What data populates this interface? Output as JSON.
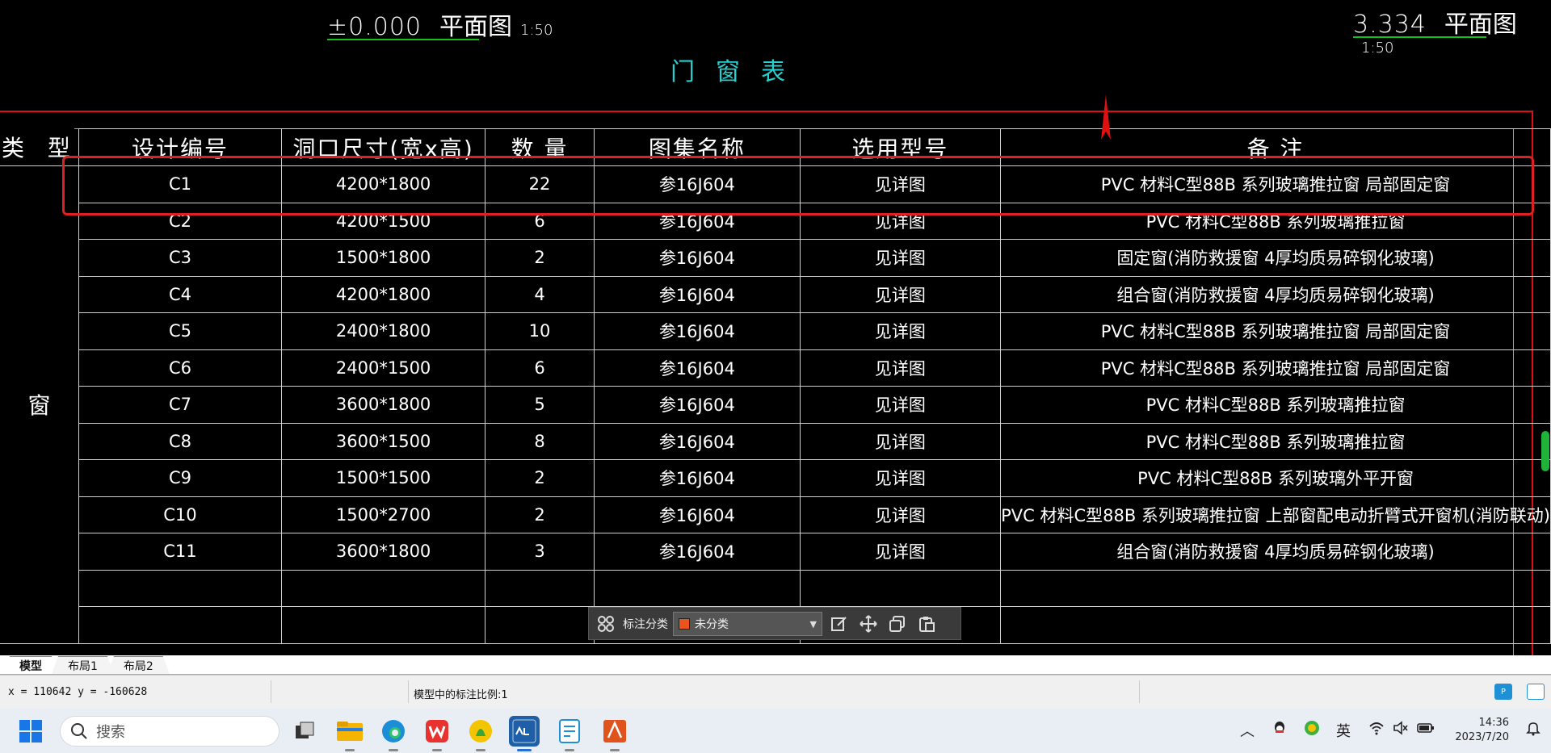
{
  "drawing": {
    "plan_left": {
      "elevation": "±0.000",
      "name": "平面图",
      "scale": "1:50"
    },
    "plan_right": {
      "elevation": "3.334",
      "name": "平面图",
      "scale": "1:50"
    },
    "table_title": "门窗表",
    "headers": [
      "类 型",
      "设计编号",
      "洞口尺寸(宽x高)",
      "数 量",
      "图集名称",
      "选用型号",
      "备 注"
    ],
    "type_label": "窗",
    "rows": [
      {
        "code": "C1",
        "size": "4200*1800",
        "qty": "22",
        "atlas": "参16J604",
        "model": "见详图",
        "note": "PVC 材料C型88B 系列玻璃推拉窗 局部固定窗"
      },
      {
        "code": "C2",
        "size": "4200*1500",
        "qty": "6",
        "atlas": "参16J604",
        "model": "见详图",
        "note": "PVC 材料C型88B 系列玻璃推拉窗"
      },
      {
        "code": "C3",
        "size": "1500*1800",
        "qty": "2",
        "atlas": "参16J604",
        "model": "见详图",
        "note": "固定窗(消防救援窗 4厚均质易碎钢化玻璃)"
      },
      {
        "code": "C4",
        "size": "4200*1800",
        "qty": "4",
        "atlas": "参16J604",
        "model": "见详图",
        "note": "组合窗(消防救援窗 4厚均质易碎钢化玻璃)"
      },
      {
        "code": "C5",
        "size": "2400*1800",
        "qty": "10",
        "atlas": "参16J604",
        "model": "见详图",
        "note": "PVC 材料C型88B 系列玻璃推拉窗 局部固定窗"
      },
      {
        "code": "C6",
        "size": "2400*1500",
        "qty": "6",
        "atlas": "参16J604",
        "model": "见详图",
        "note": "PVC 材料C型88B 系列玻璃推拉窗 局部固定窗"
      },
      {
        "code": "C7",
        "size": "3600*1800",
        "qty": "5",
        "atlas": "参16J604",
        "model": "见详图",
        "note": "PVC 材料C型88B 系列玻璃推拉窗"
      },
      {
        "code": "C8",
        "size": "3600*1500",
        "qty": "8",
        "atlas": "参16J604",
        "model": "见详图",
        "note": "PVC 材料C型88B 系列玻璃推拉窗"
      },
      {
        "code": "C9",
        "size": "1500*1500",
        "qty": "2",
        "atlas": "参16J604",
        "model": "见详图",
        "note": "PVC 材料C型88B 系列玻璃外平开窗"
      },
      {
        "code": "C10",
        "size": "1500*2700",
        "qty": "2",
        "atlas": "参16J604",
        "model": "见详图",
        "note": "PVC 材料C型88B 系列玻璃推拉窗 上部窗配电动折臂式开窗机(消防联动)"
      },
      {
        "code": "C11",
        "size": "3600*1800",
        "qty": "3",
        "atlas": "参16J604",
        "model": "见详图",
        "note": "组合窗(消防救援窗 4厚均质易碎钢化玻璃)"
      }
    ]
  },
  "annotation_toolbar": {
    "label": "标注分类",
    "category": "未分类",
    "category_color": "#e8541e"
  },
  "layout_tabs": [
    "模型",
    "布局1",
    "布局2"
  ],
  "status": {
    "coords": "x = 110642   y = -160628",
    "scale_text": "模型中的标注比例:1"
  },
  "taskbar": {
    "search_placeholder": "搜索",
    "ime": "英",
    "time": "14:36",
    "date": "2023/7/20"
  },
  "colors": {
    "background": "#000000",
    "title_cyan": "#27d0d0",
    "border_red": "#e01010",
    "underline_green": "#12c21a"
  }
}
